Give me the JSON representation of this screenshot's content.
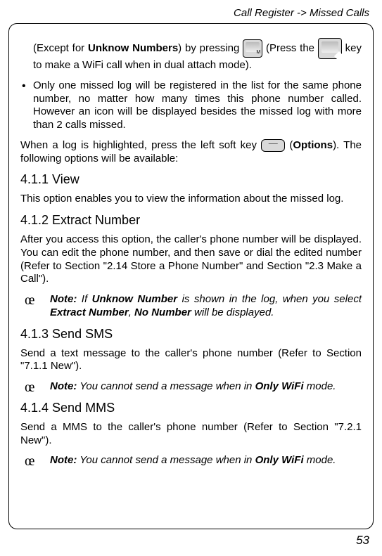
{
  "header": "Call Register -> Missed Calls",
  "para1_a": "(Except for ",
  "para1_b": "Unknow Numbers",
  "para1_c": ") by pressing ",
  "para1_d": " (Press the ",
  "para1_e": " key to make a WiFi call when in dual attach mode).",
  "bullet1": "Only one missed log will be registered in the list for the same phone number, no matter how many times this phone number called. However an icon will be displayed besides the missed log with more than 2 calls missed.",
  "para2_a": "When a log is highlighted, press the left soft key ",
  "para2_b": " (",
  "para2_c": "Options",
  "para2_d": "). The following options will be available:",
  "sec1_title": "4.1.1 View",
  "sec1_body": "This option enables you to view the information about the missed log.",
  "sec2_title": "4.1.2 Extract Number",
  "sec2_body": "After you access this option, the caller's phone number will be displayed. You can edit the phone number, and then save or dial the edited number (Refer to Section \"2.14 Store a Phone Number\" and Section \"2.3 Make a Call\").",
  "note_marker": "œ",
  "note_label": "Note:",
  "note1_a": " If ",
  "note1_b": "Unknow Number",
  "note1_c": " is shown in the log, when you select ",
  "note1_d": "Extract Number",
  "note1_e": ", ",
  "note1_f": "No Number",
  "note1_g": " will be displayed.",
  "sec3_title": "4.1.3 Send SMS",
  "sec3_body": "Send a text message to the caller's phone number (Refer to Section \"7.1.1 New\").",
  "note2_a": " You cannot send a message when in ",
  "note2_b": "Only WiFi",
  "note2_c": " mode.",
  "sec4_title": "4.1.4 Send MMS",
  "sec4_body": "Send a MMS to the caller's phone number (Refer to Section \"7.2.1 New\").",
  "note3_a": " You cannot send a message when in ",
  "note3_b": "Only WiFi",
  "note3_c": " mode.",
  "page_num": "53"
}
